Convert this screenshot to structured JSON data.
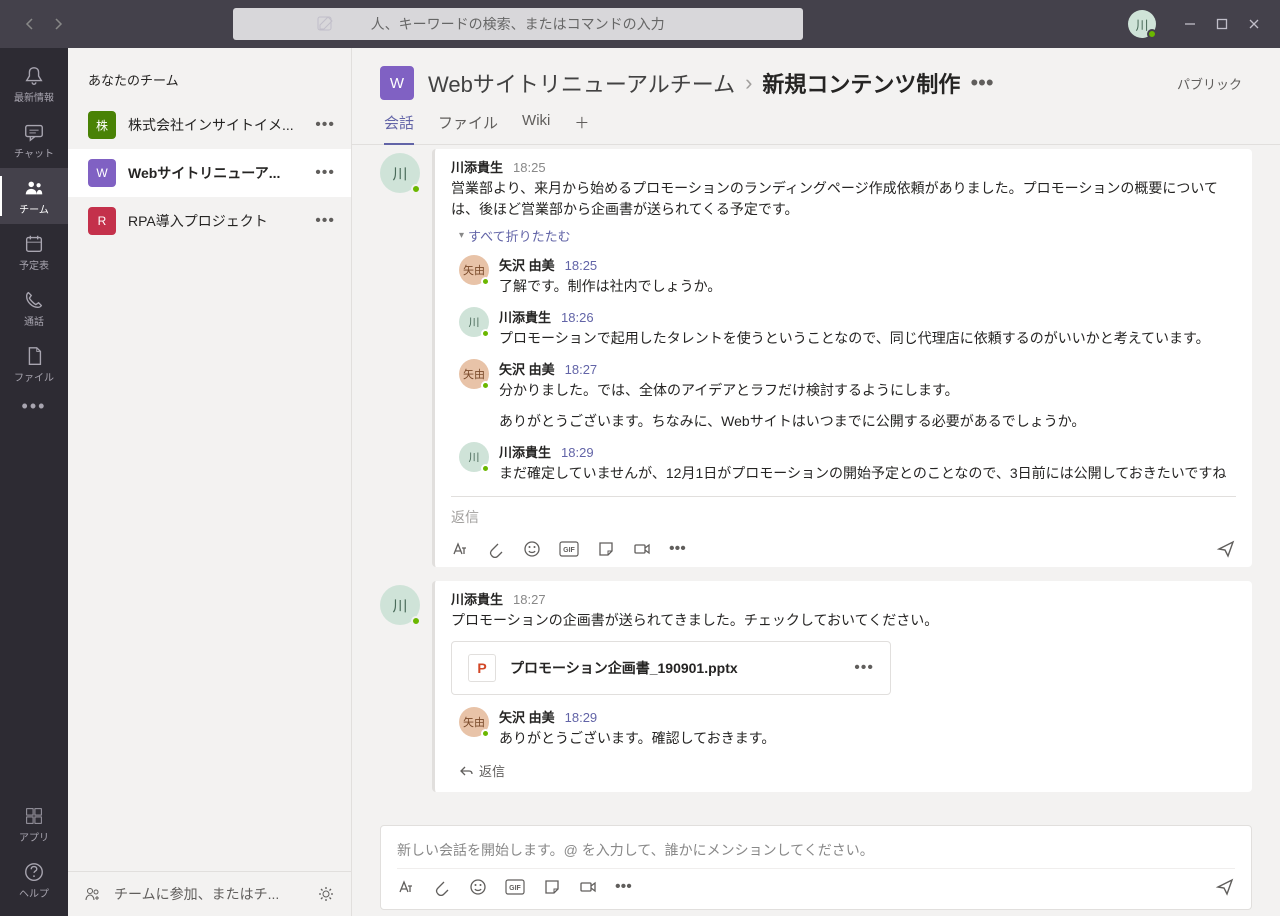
{
  "titlebar": {
    "search_placeholder": "人、キーワードの検索、またはコマンドの入力",
    "user_initial": "川"
  },
  "rail": {
    "items": [
      {
        "label": "最新情報"
      },
      {
        "label": "チャット"
      },
      {
        "label": "チーム"
      },
      {
        "label": "予定表"
      },
      {
        "label": "通話"
      },
      {
        "label": "ファイル"
      }
    ],
    "apps_label": "アプリ",
    "help_label": "ヘルプ"
  },
  "teams_pane": {
    "header": "あなたのチーム",
    "teams": [
      {
        "initial": "株",
        "color": "#498205",
        "name": "株式会社インサイトイメ..."
      },
      {
        "initial": "W",
        "color": "#8061c3",
        "name": "Webサイトリニューア..."
      },
      {
        "initial": "R",
        "color": "#c4314b",
        "name": "RPA導入プロジェクト"
      }
    ],
    "join_label": "チームに参加、またはチ..."
  },
  "channel_header": {
    "icon_initial": "W",
    "team": "Webサイトリニューアルチーム",
    "channel": "新規コンテンツ制作",
    "public_badge": "パブリック"
  },
  "tabs": {
    "items": [
      "会話",
      "ファイル",
      "Wiki"
    ]
  },
  "thread1": {
    "avatar": "川",
    "author": "川添貴生",
    "time": "18:25",
    "text": "営業部より、来月から始めるプロモーションのランディングページ作成依頼がありました。プロモーションの概要については、後ほど営業部から企画書が送られてくる予定です。",
    "collapse": "すべて折りたたむ",
    "replies": [
      {
        "avatar": "矢由",
        "cls": "y",
        "author": "矢沢 由美",
        "time": "18:25",
        "text": "了解です。制作は社内でしょうか。"
      },
      {
        "avatar": "川",
        "cls": "k",
        "author": "川添貴生",
        "time": "18:26",
        "text": "プロモーションで起用したタレントを使うということなので、同じ代理店に依頼するのがいいかと考えています。"
      },
      {
        "avatar": "矢由",
        "cls": "y",
        "author": "矢沢 由美",
        "time": "18:27",
        "text": "分かりました。では、全体のアイデアとラフだけ検討するようにします。\n\nありがとうございます。ちなみに、Webサイトはいつまでに公開する必要があるでしょうか。"
      },
      {
        "avatar": "川",
        "cls": "k",
        "author": "川添貴生",
        "time": "18:29",
        "text": "まだ確定していませんが、12月1日がプロモーションの開始予定とのことなので、3日前には公開しておきたいですね"
      }
    ],
    "reply_placeholder": "返信"
  },
  "thread2": {
    "avatar": "川",
    "author": "川添貴生",
    "time": "18:27",
    "text": "プロモーションの企画書が送られてきました。チェックしておいてください。",
    "attachment": "プロモーション企画書_190901.pptx",
    "replies": [
      {
        "avatar": "矢由",
        "cls": "y",
        "author": "矢沢 由美",
        "time": "18:29",
        "text": "ありがとうございます。確認しておきます。"
      }
    ],
    "reply_link": "返信"
  },
  "compose": {
    "placeholder": "新しい会話を開始します。@ を入力して、誰かにメンションしてください。"
  }
}
